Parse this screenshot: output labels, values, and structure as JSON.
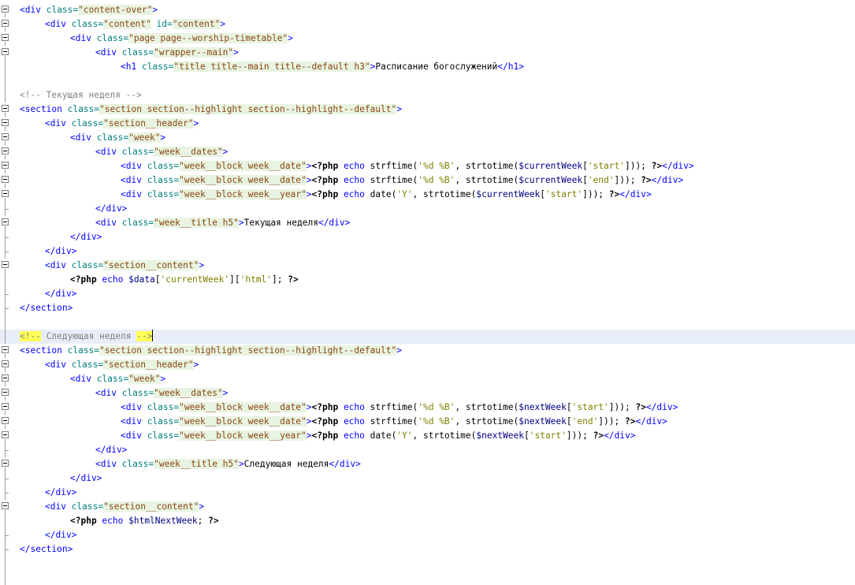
{
  "editor": {
    "language": "php",
    "colors": {
      "background": "#ffffff",
      "tag": "#0000ff",
      "attribute": "#008080",
      "string": "#8b4513",
      "comment": "#808080",
      "highlight": "#ffff55",
      "current_line": "#e8eef8"
    },
    "lines": [
      {
        "gutter": "fold",
        "indent": 0,
        "tokens": [
          [
            "tag",
            "<div "
          ],
          [
            "attr",
            "class="
          ],
          [
            "str",
            "\"content-over\""
          ],
          [
            "tag",
            ">"
          ]
        ]
      },
      {
        "gutter": "fold",
        "indent": 1,
        "tokens": [
          [
            "tag",
            "<div "
          ],
          [
            "attr",
            "class="
          ],
          [
            "str",
            "\"content\""
          ],
          [
            "attr",
            " id="
          ],
          [
            "str",
            "\"content\""
          ],
          [
            "tag",
            ">"
          ]
        ]
      },
      {
        "gutter": "fold",
        "indent": 2,
        "tokens": [
          [
            "tag",
            "<div "
          ],
          [
            "attr",
            "class="
          ],
          [
            "str",
            "\"page page--worship-timetable\""
          ],
          [
            "tag",
            ">"
          ]
        ]
      },
      {
        "gutter": "fold",
        "indent": 3,
        "tokens": [
          [
            "tag",
            "<div "
          ],
          [
            "attr",
            "class="
          ],
          [
            "str",
            "\"wrapper--main\""
          ],
          [
            "tag",
            ">"
          ]
        ]
      },
      {
        "gutter": "line",
        "indent": 4,
        "tokens": [
          [
            "tag",
            "<h1 "
          ],
          [
            "attr",
            "class="
          ],
          [
            "str",
            "\"title title--main title--default h3\""
          ],
          [
            "tag",
            ">"
          ],
          [
            "txt",
            "Расписание богослужений"
          ],
          [
            "tag",
            "</h1>"
          ]
        ]
      },
      {
        "gutter": "line",
        "indent": 0,
        "tokens": []
      },
      {
        "gutter": "line",
        "indent": 0,
        "tokens": [
          [
            "cmt",
            "<!-- Текущая неделя -->"
          ]
        ]
      },
      {
        "gutter": "fold",
        "indent": 0,
        "tokens": [
          [
            "tag",
            "<section "
          ],
          [
            "attr",
            "class="
          ],
          [
            "str",
            "\"section section--highlight section--highlight--default\""
          ],
          [
            "tag",
            ">"
          ]
        ]
      },
      {
        "gutter": "fold",
        "indent": 1,
        "tokens": [
          [
            "tag",
            "<div "
          ],
          [
            "attr",
            "class="
          ],
          [
            "str",
            "\"section__header\""
          ],
          [
            "tag",
            ">"
          ]
        ]
      },
      {
        "gutter": "fold",
        "indent": 2,
        "tokens": [
          [
            "tag",
            "<div "
          ],
          [
            "attr",
            "class="
          ],
          [
            "str",
            "\"week\""
          ],
          [
            "tag",
            ">"
          ]
        ]
      },
      {
        "gutter": "fold",
        "indent": 3,
        "tokens": [
          [
            "tag",
            "<div "
          ],
          [
            "attr",
            "class="
          ],
          [
            "str",
            "\"week__dates\""
          ],
          [
            "tag",
            ">"
          ]
        ]
      },
      {
        "gutter": "fold",
        "indent": 4,
        "tokens": [
          [
            "tag",
            "<div "
          ],
          [
            "attr",
            "class="
          ],
          [
            "str",
            "\"week__block week__date\""
          ],
          [
            "tag",
            ">"
          ],
          [
            "php",
            "<?php"
          ],
          [
            "kw",
            " echo "
          ],
          [
            "txt",
            "strftime("
          ],
          [
            "sstr",
            "'%d %B'"
          ],
          [
            "txt",
            ", strtotime("
          ],
          [
            "var",
            "$currentWeek"
          ],
          [
            "txt",
            "["
          ],
          [
            "sstr",
            "'start'"
          ],
          [
            "txt",
            "])); "
          ],
          [
            "php",
            "?>"
          ],
          [
            "tag",
            "</div>"
          ]
        ]
      },
      {
        "gutter": "fold",
        "indent": 4,
        "tokens": [
          [
            "tag",
            "<div "
          ],
          [
            "attr",
            "class="
          ],
          [
            "str",
            "\"week__block week__date\""
          ],
          [
            "tag",
            ">"
          ],
          [
            "php",
            "<?php"
          ],
          [
            "kw",
            " echo "
          ],
          [
            "txt",
            "strftime("
          ],
          [
            "sstr",
            "'%d %B'"
          ],
          [
            "txt",
            ", strtotime("
          ],
          [
            "var",
            "$currentWeek"
          ],
          [
            "txt",
            "["
          ],
          [
            "sstr",
            "'end'"
          ],
          [
            "txt",
            "])); "
          ],
          [
            "php",
            "?>"
          ],
          [
            "tag",
            "</div>"
          ]
        ]
      },
      {
        "gutter": "fold",
        "indent": 4,
        "tokens": [
          [
            "tag",
            "<div "
          ],
          [
            "attr",
            "class="
          ],
          [
            "str",
            "\"week__block week__year\""
          ],
          [
            "tag",
            ">"
          ],
          [
            "php",
            "<?php"
          ],
          [
            "kw",
            " echo "
          ],
          [
            "txt",
            "date("
          ],
          [
            "sstr",
            "'Y'"
          ],
          [
            "txt",
            ", strtotime("
          ],
          [
            "var",
            "$currentWeek"
          ],
          [
            "txt",
            "["
          ],
          [
            "sstr",
            "'start'"
          ],
          [
            "txt",
            "])); "
          ],
          [
            "php",
            "?>"
          ],
          [
            "tag",
            "</div>"
          ]
        ]
      },
      {
        "gutter": "tick",
        "indent": 3,
        "tokens": [
          [
            "tag",
            "</div>"
          ]
        ]
      },
      {
        "gutter": "fold",
        "indent": 3,
        "tokens": [
          [
            "tag",
            "<div "
          ],
          [
            "attr",
            "class="
          ],
          [
            "str",
            "\"week__title h5\""
          ],
          [
            "tag",
            ">"
          ],
          [
            "txt",
            "Текущая неделя"
          ],
          [
            "tag",
            "</div>"
          ]
        ]
      },
      {
        "gutter": "tick",
        "indent": 2,
        "tokens": [
          [
            "tag",
            "</div>"
          ]
        ]
      },
      {
        "gutter": "tick",
        "indent": 1,
        "tokens": [
          [
            "tag",
            "</div>"
          ]
        ]
      },
      {
        "gutter": "fold",
        "indent": 1,
        "tokens": [
          [
            "tag",
            "<div "
          ],
          [
            "attr",
            "class="
          ],
          [
            "str",
            "\"section__content\""
          ],
          [
            "tag",
            ">"
          ]
        ]
      },
      {
        "gutter": "line",
        "indent": 2,
        "tokens": [
          [
            "php",
            "<?php"
          ],
          [
            "kw",
            " echo "
          ],
          [
            "var",
            "$data"
          ],
          [
            "txt",
            "["
          ],
          [
            "sstr",
            "'currentWeek'"
          ],
          [
            "txt",
            "]["
          ],
          [
            "sstr",
            "'html'"
          ],
          [
            "txt",
            "]; "
          ],
          [
            "php",
            "?>"
          ]
        ]
      },
      {
        "gutter": "tick",
        "indent": 1,
        "tokens": [
          [
            "tag",
            "</div>"
          ]
        ]
      },
      {
        "gutter": "tick",
        "indent": 0,
        "tokens": [
          [
            "tag",
            "</section>"
          ]
        ]
      },
      {
        "gutter": "line",
        "indent": 0,
        "tokens": []
      },
      {
        "gutter": "line",
        "indent": 0,
        "current": true,
        "tokens": [
          [
            "cmt hl",
            "<!--"
          ],
          [
            "cmt",
            " Следующая неделя "
          ],
          [
            "cmt hl",
            "-->"
          ]
        ]
      },
      {
        "gutter": "fold",
        "indent": 0,
        "tokens": [
          [
            "tag",
            "<section "
          ],
          [
            "attr",
            "class="
          ],
          [
            "str",
            "\"section section--highlight section--highlight--default\""
          ],
          [
            "tag",
            ">"
          ]
        ]
      },
      {
        "gutter": "fold",
        "indent": 1,
        "tokens": [
          [
            "tag",
            "<div "
          ],
          [
            "attr",
            "class="
          ],
          [
            "str",
            "\"section__header\""
          ],
          [
            "tag",
            ">"
          ]
        ]
      },
      {
        "gutter": "fold",
        "indent": 2,
        "tokens": [
          [
            "tag",
            "<div "
          ],
          [
            "attr",
            "class="
          ],
          [
            "str",
            "\"week\""
          ],
          [
            "tag",
            ">"
          ]
        ]
      },
      {
        "gutter": "fold",
        "indent": 3,
        "tokens": [
          [
            "tag",
            "<div "
          ],
          [
            "attr",
            "class="
          ],
          [
            "str",
            "\"week__dates\""
          ],
          [
            "tag",
            ">"
          ]
        ]
      },
      {
        "gutter": "fold",
        "indent": 4,
        "tokens": [
          [
            "tag",
            "<div "
          ],
          [
            "attr",
            "class="
          ],
          [
            "str",
            "\"week__block week__date\""
          ],
          [
            "tag",
            ">"
          ],
          [
            "php",
            "<?php"
          ],
          [
            "kw",
            " echo "
          ],
          [
            "txt",
            "strftime("
          ],
          [
            "sstr",
            "'%d %B'"
          ],
          [
            "txt",
            ", strtotime("
          ],
          [
            "var",
            "$nextWeek"
          ],
          [
            "txt",
            "["
          ],
          [
            "sstr",
            "'start'"
          ],
          [
            "txt",
            "])); "
          ],
          [
            "php",
            "?>"
          ],
          [
            "tag",
            "</div>"
          ]
        ]
      },
      {
        "gutter": "fold",
        "indent": 4,
        "tokens": [
          [
            "tag",
            "<div "
          ],
          [
            "attr",
            "class="
          ],
          [
            "str",
            "\"week__block week__date\""
          ],
          [
            "tag",
            ">"
          ],
          [
            "php",
            "<?php"
          ],
          [
            "kw",
            " echo "
          ],
          [
            "txt",
            "strftime("
          ],
          [
            "sstr",
            "'%d %B'"
          ],
          [
            "txt",
            ", strtotime("
          ],
          [
            "var",
            "$nextWeek"
          ],
          [
            "txt",
            "["
          ],
          [
            "sstr",
            "'end'"
          ],
          [
            "txt",
            "])); "
          ],
          [
            "php",
            "?>"
          ],
          [
            "tag",
            "</div>"
          ]
        ]
      },
      {
        "gutter": "fold",
        "indent": 4,
        "tokens": [
          [
            "tag",
            "<div "
          ],
          [
            "attr",
            "class="
          ],
          [
            "str",
            "\"week__block week__year\""
          ],
          [
            "tag",
            ">"
          ],
          [
            "php",
            "<?php"
          ],
          [
            "kw",
            " echo "
          ],
          [
            "txt",
            "date("
          ],
          [
            "sstr",
            "'Y'"
          ],
          [
            "txt",
            ", strtotime("
          ],
          [
            "var",
            "$nextWeek"
          ],
          [
            "txt",
            "["
          ],
          [
            "sstr",
            "'start'"
          ],
          [
            "txt",
            "])); "
          ],
          [
            "php",
            "?>"
          ],
          [
            "tag",
            "</div>"
          ]
        ]
      },
      {
        "gutter": "tick",
        "indent": 3,
        "tokens": [
          [
            "tag",
            "</div>"
          ]
        ]
      },
      {
        "gutter": "fold",
        "indent": 3,
        "tokens": [
          [
            "tag",
            "<div "
          ],
          [
            "attr",
            "class="
          ],
          [
            "str",
            "\"week__title h5\""
          ],
          [
            "tag",
            ">"
          ],
          [
            "txt",
            "Следующая неделя"
          ],
          [
            "tag",
            "</div>"
          ]
        ]
      },
      {
        "gutter": "tick",
        "indent": 2,
        "tokens": [
          [
            "tag",
            "</div>"
          ]
        ]
      },
      {
        "gutter": "tick",
        "indent": 1,
        "tokens": [
          [
            "tag",
            "</div>"
          ]
        ]
      },
      {
        "gutter": "fold",
        "indent": 1,
        "tokens": [
          [
            "tag",
            "<div "
          ],
          [
            "attr",
            "class="
          ],
          [
            "str",
            "\"section__content\""
          ],
          [
            "tag",
            ">"
          ]
        ]
      },
      {
        "gutter": "line",
        "indent": 2,
        "tokens": [
          [
            "php",
            "<?php"
          ],
          [
            "kw",
            " echo "
          ],
          [
            "var",
            "$htmlNextWeek"
          ],
          [
            "txt",
            "; "
          ],
          [
            "php",
            "?>"
          ]
        ]
      },
      {
        "gutter": "tick",
        "indent": 1,
        "tokens": [
          [
            "tag",
            "</div>"
          ]
        ]
      },
      {
        "gutter": "tick",
        "indent": 0,
        "tokens": [
          [
            "tag",
            "</section>"
          ]
        ]
      },
      {
        "gutter": "line",
        "indent": 0,
        "tokens": []
      },
      {
        "gutter": "line",
        "indent": 0,
        "tokens": []
      }
    ]
  }
}
